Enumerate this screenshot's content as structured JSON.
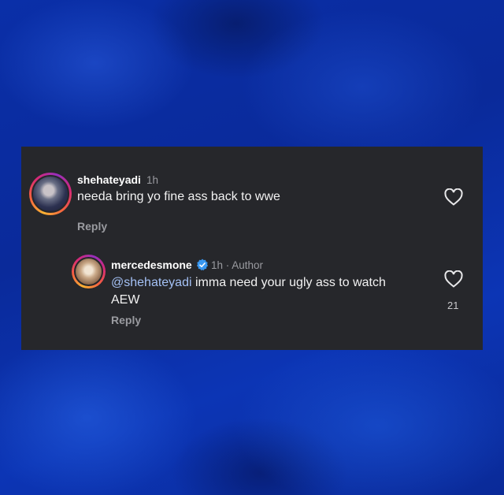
{
  "comment": {
    "username": "shehateyadi",
    "time": "1h",
    "text": "needa bring yo fine ass back to wwe",
    "reply_label": "Reply",
    "like_icon": "heart-outline-icon"
  },
  "reply": {
    "username": "mercedesmone",
    "meta": "1h · Author",
    "mention": "@shehateyadi",
    "text_line1": "imma need your ugly ass to watch",
    "text_line2": "AEW",
    "reply_label": "Reply",
    "likes": "21",
    "verified_icon": "verified-badge-icon",
    "like_icon": "heart-outline-icon"
  },
  "colors": {
    "card_bg": "#26272b",
    "mention": "#a4c1f5",
    "verified": "#3897f0",
    "secondary_text": "#9a9ba0"
  }
}
